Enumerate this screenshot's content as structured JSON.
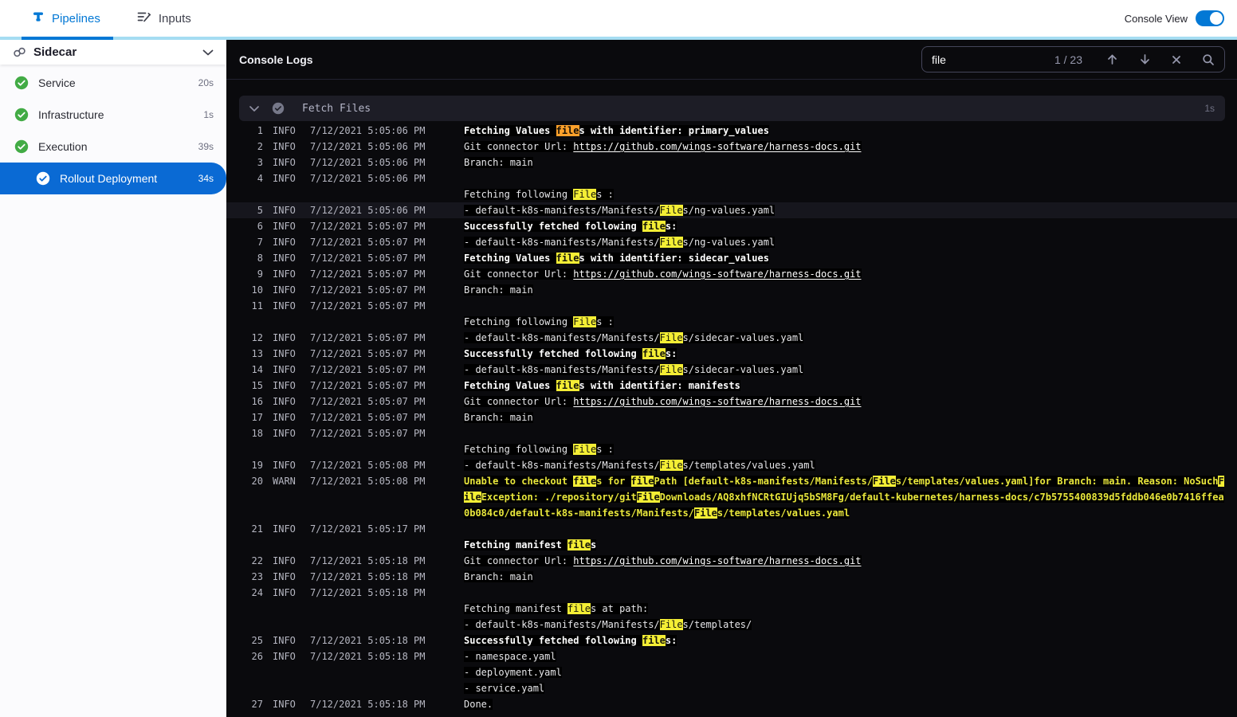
{
  "topbar": {
    "tabs": [
      {
        "label": "Pipelines"
      },
      {
        "label": "Inputs"
      }
    ],
    "active_tab": "Pipelines",
    "console_view": {
      "label": "Console View",
      "enabled": true
    }
  },
  "sidebar": {
    "title": "Sidecar",
    "items": [
      {
        "label": "Service",
        "duration": "20s",
        "status": "success",
        "selected": false
      },
      {
        "label": "Infrastructure",
        "duration": "1s",
        "status": "success",
        "selected": false
      },
      {
        "label": "Execution",
        "duration": "39s",
        "status": "success",
        "selected": false
      },
      {
        "label": "Rollout Deployment",
        "duration": "34s",
        "status": "success",
        "selected": true
      }
    ]
  },
  "console": {
    "title": "Console Logs",
    "search": {
      "value": "file",
      "match_count": "1 / 23",
      "icons": [
        "arrow-up-icon",
        "arrow-down-icon",
        "close-icon",
        "search-icon"
      ]
    },
    "section": {
      "title": "Fetch Files",
      "duration": "1s"
    },
    "logs": [
      {
        "n": "1",
        "lvl": "INFO",
        "t": "7/12/2021 5:05:06 PM",
        "rows": [
          [
            [
              "Fetching Values ",
              "b"
            ],
            [
              "file",
              "b",
              "o"
            ],
            [
              "s with identifier: primary_values",
              "b"
            ]
          ]
        ]
      },
      {
        "n": "2",
        "lvl": "INFO",
        "t": "7/12/2021 5:05:06 PM",
        "rows": [
          [
            [
              "Git connector Url: ",
              "n"
            ],
            [
              "https://github.com/wings-software/harness-docs.git",
              "l"
            ]
          ]
        ]
      },
      {
        "n": "3",
        "lvl": "INFO",
        "t": "7/12/2021 5:05:06 PM",
        "rows": [
          [
            [
              "Branch: main",
              "n"
            ]
          ]
        ]
      },
      {
        "n": "4",
        "lvl": "INFO",
        "t": "7/12/2021 5:05:06 PM",
        "rows": [
          [],
          [
            [
              "Fetching following ",
              "n"
            ],
            [
              "File",
              "n",
              "y"
            ],
            [
              "s :",
              "n"
            ]
          ]
        ]
      },
      {
        "n": "5",
        "lvl": "INFO",
        "t": "7/12/2021 5:05:06 PM",
        "hl": true,
        "rows": [
          [
            [
              "- default-k8s-manifests/Manifests/",
              "n"
            ],
            [
              "File",
              "n",
              "y"
            ],
            [
              "s/ng-values.yaml",
              "n"
            ]
          ]
        ]
      },
      {
        "n": "6",
        "lvl": "INFO",
        "t": "7/12/2021 5:05:07 PM",
        "rows": [
          [
            [
              "Successfully fetched following ",
              "b"
            ],
            [
              "file",
              "b",
              "y"
            ],
            [
              "s:",
              "b"
            ]
          ]
        ]
      },
      {
        "n": "7",
        "lvl": "INFO",
        "t": "7/12/2021 5:05:07 PM",
        "rows": [
          [
            [
              "- default-k8s-manifests/Manifests/",
              "n"
            ],
            [
              "File",
              "n",
              "y"
            ],
            [
              "s/ng-values.yaml",
              "n"
            ]
          ]
        ]
      },
      {
        "n": "8",
        "lvl": "INFO",
        "t": "7/12/2021 5:05:07 PM",
        "rows": [
          [
            [
              "Fetching Values ",
              "b"
            ],
            [
              "file",
              "b",
              "y"
            ],
            [
              "s with identifier: sidecar_values",
              "b"
            ]
          ]
        ]
      },
      {
        "n": "9",
        "lvl": "INFO",
        "t": "7/12/2021 5:05:07 PM",
        "rows": [
          [
            [
              "Git connector Url: ",
              "n"
            ],
            [
              "https://github.com/wings-software/harness-docs.git",
              "l"
            ]
          ]
        ]
      },
      {
        "n": "10",
        "lvl": "INFO",
        "t": "7/12/2021 5:05:07 PM",
        "rows": [
          [
            [
              "Branch: main",
              "n"
            ]
          ]
        ]
      },
      {
        "n": "11",
        "lvl": "INFO",
        "t": "7/12/2021 5:05:07 PM",
        "rows": [
          [],
          [
            [
              "Fetching following ",
              "n"
            ],
            [
              "File",
              "n",
              "y"
            ],
            [
              "s :",
              "n"
            ]
          ]
        ]
      },
      {
        "n": "12",
        "lvl": "INFO",
        "t": "7/12/2021 5:05:07 PM",
        "rows": [
          [
            [
              "- default-k8s-manifests/Manifests/",
              "n"
            ],
            [
              "File",
              "n",
              "y"
            ],
            [
              "s/sidecar-values.yaml",
              "n"
            ]
          ]
        ]
      },
      {
        "n": "13",
        "lvl": "INFO",
        "t": "7/12/2021 5:05:07 PM",
        "rows": [
          [
            [
              "Successfully fetched following ",
              "b"
            ],
            [
              "file",
              "b",
              "y"
            ],
            [
              "s:",
              "b"
            ]
          ]
        ]
      },
      {
        "n": "14",
        "lvl": "INFO",
        "t": "7/12/2021 5:05:07 PM",
        "rows": [
          [
            [
              "- default-k8s-manifests/Manifests/",
              "n"
            ],
            [
              "File",
              "n",
              "y"
            ],
            [
              "s/sidecar-values.yaml",
              "n"
            ]
          ]
        ]
      },
      {
        "n": "15",
        "lvl": "INFO",
        "t": "7/12/2021 5:05:07 PM",
        "rows": [
          [
            [
              "Fetching Values ",
              "b"
            ],
            [
              "file",
              "b",
              "y"
            ],
            [
              "s with identifier: manifests",
              "b"
            ]
          ]
        ]
      },
      {
        "n": "16",
        "lvl": "INFO",
        "t": "7/12/2021 5:05:07 PM",
        "rows": [
          [
            [
              "Git connector Url: ",
              "n"
            ],
            [
              "https://github.com/wings-software/harness-docs.git",
              "l"
            ]
          ]
        ]
      },
      {
        "n": "17",
        "lvl": "INFO",
        "t": "7/12/2021 5:05:07 PM",
        "rows": [
          [
            [
              "Branch: main",
              "n"
            ]
          ]
        ]
      },
      {
        "n": "18",
        "lvl": "INFO",
        "t": "7/12/2021 5:05:07 PM",
        "rows": [
          [],
          [
            [
              "Fetching following ",
              "n"
            ],
            [
              "File",
              "n",
              "y"
            ],
            [
              "s :",
              "n"
            ]
          ]
        ]
      },
      {
        "n": "19",
        "lvl": "INFO",
        "t": "7/12/2021 5:05:08 PM",
        "rows": [
          [
            [
              "- default-k8s-manifests/Manifests/",
              "n"
            ],
            [
              "File",
              "n",
              "y"
            ],
            [
              "s/templates/values.yaml",
              "n"
            ]
          ]
        ]
      },
      {
        "n": "20",
        "lvl": "WARN",
        "t": "7/12/2021 5:05:08 PM",
        "rows": [
          [
            [
              "Unable to checkout ",
              "w"
            ],
            [
              "file",
              "w",
              "y"
            ],
            [
              "s for ",
              "w"
            ],
            [
              "file",
              "w",
              "y"
            ],
            [
              "Path [default-k8s-manifests/Manifests/",
              "w"
            ],
            [
              "File",
              "w",
              "y"
            ],
            [
              "s/templates/values.yaml]for Branch: main. Reason: NoSuch",
              "w"
            ],
            [
              "F",
              "w",
              "y"
            ]
          ],
          [
            [
              "ile",
              "w",
              "y"
            ],
            [
              "Exception: ./repository/git",
              "w"
            ],
            [
              "File",
              "w",
              "y"
            ],
            [
              "Downloads/AQ8xhfNCRtGIUjq5bSM8Fg/default-kubernetes/harness-docs/c7b5755400839d5fddb046e0b7416ffea",
              "w"
            ]
          ],
          [
            [
              "0b084c0/default-k8s-manifests/Manifests/",
              "w"
            ],
            [
              "File",
              "w",
              "y"
            ],
            [
              "s/templates/values.yaml",
              "w"
            ]
          ]
        ]
      },
      {
        "n": "21",
        "lvl": "INFO",
        "t": "7/12/2021 5:05:17 PM",
        "rows": [
          [],
          [
            [
              "Fetching manifest ",
              "b"
            ],
            [
              "file",
              "b",
              "y"
            ],
            [
              "s",
              "b"
            ]
          ]
        ]
      },
      {
        "n": "22",
        "lvl": "INFO",
        "t": "7/12/2021 5:05:18 PM",
        "rows": [
          [
            [
              "Git connector Url: ",
              "n"
            ],
            [
              "https://github.com/wings-software/harness-docs.git",
              "l"
            ]
          ]
        ]
      },
      {
        "n": "23",
        "lvl": "INFO",
        "t": "7/12/2021 5:05:18 PM",
        "rows": [
          [
            [
              "Branch: main",
              "n"
            ]
          ]
        ]
      },
      {
        "n": "24",
        "lvl": "INFO",
        "t": "7/12/2021 5:05:18 PM",
        "rows": [
          [],
          [
            [
              "Fetching manifest ",
              "n"
            ],
            [
              "file",
              "n",
              "y"
            ],
            [
              "s at path:",
              "n"
            ]
          ],
          [
            [
              "- default-k8s-manifests/Manifests/",
              "n"
            ],
            [
              "File",
              "n",
              "y"
            ],
            [
              "s/templates/",
              "n"
            ]
          ]
        ]
      },
      {
        "n": "25",
        "lvl": "INFO",
        "t": "7/12/2021 5:05:18 PM",
        "rows": [
          [
            [
              "Successfully fetched following ",
              "b"
            ],
            [
              "file",
              "b",
              "y"
            ],
            [
              "s:",
              "b"
            ]
          ]
        ]
      },
      {
        "n": "26",
        "lvl": "INFO",
        "t": "7/12/2021 5:05:18 PM",
        "rows": [
          [
            [
              "- namespace.yaml",
              "n"
            ]
          ],
          [
            [
              "- deployment.yaml",
              "n"
            ]
          ],
          [
            [
              "- service.yaml",
              "n"
            ]
          ]
        ]
      },
      {
        "n": "27",
        "lvl": "INFO",
        "t": "7/12/2021 5:05:18 PM",
        "rows": [
          [
            [
              "Done.",
              "n"
            ]
          ]
        ]
      }
    ]
  },
  "colors": {
    "accent_blue": "#0278d5",
    "selected_item_blue": "#0a6ad4",
    "success_green": "#42ab45",
    "topbar_divider_cyan": "#a5ddf2",
    "console_bg": "#0a0a0d",
    "warn_yellow": "#e9e73c",
    "search_highlight": "#f4ee35",
    "search_highlight_active": "#ffa12b"
  }
}
